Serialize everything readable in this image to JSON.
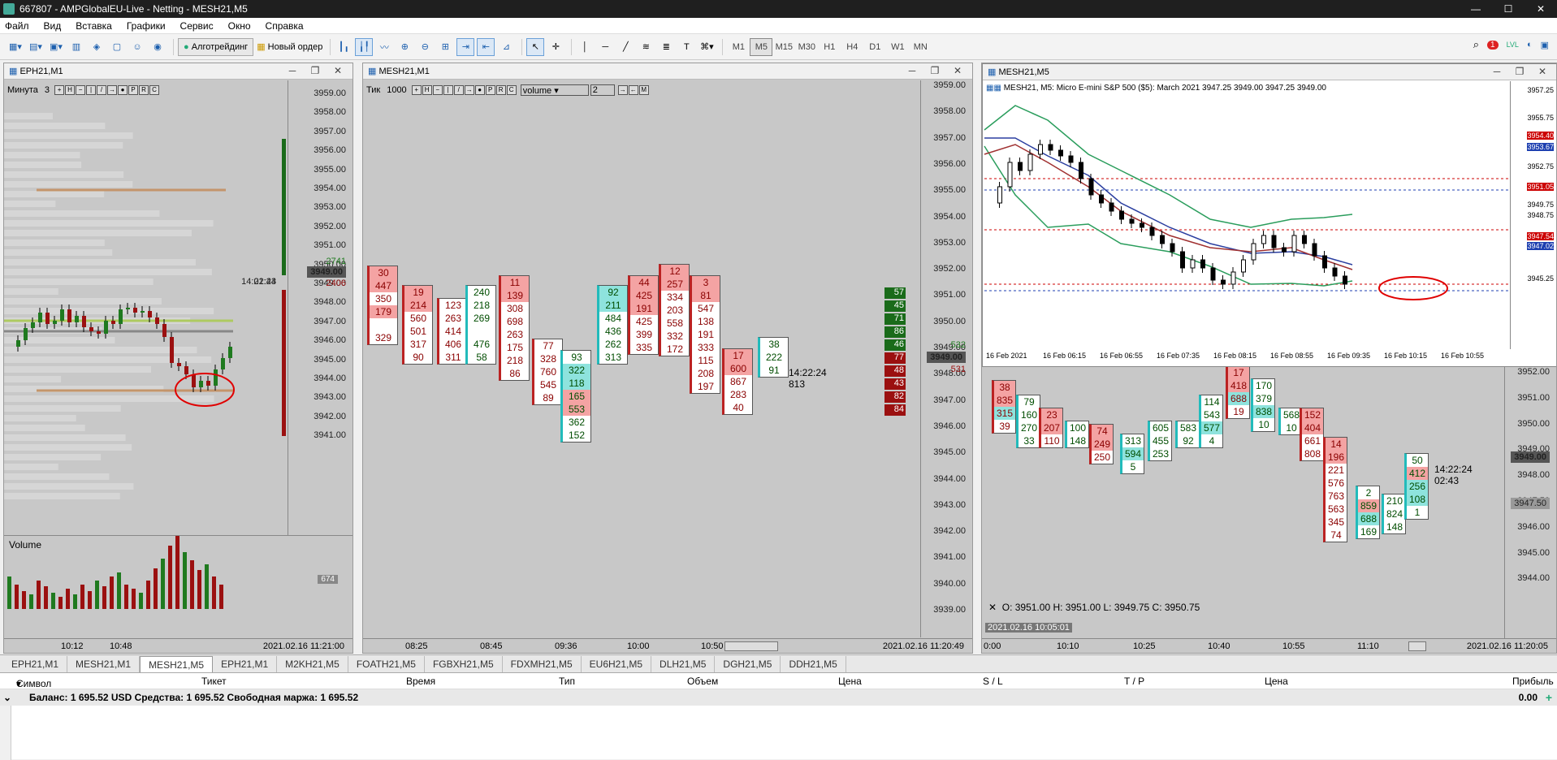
{
  "app": {
    "title": "667807 - AMPGlobalEU-Live - Netting - MESH21,M5",
    "window_controls": [
      "—",
      "☐",
      "✕"
    ]
  },
  "menu": [
    "Файл",
    "Вид",
    "Вставка",
    "Графики",
    "Сервис",
    "Окно",
    "Справка"
  ],
  "toolbar": {
    "algo_label": "Алготрейдинг",
    "new_order_label": "Новый ордер",
    "timeframes": [
      "M1",
      "M5",
      "M15",
      "M30",
      "H1",
      "H4",
      "D1",
      "W1",
      "MN"
    ],
    "active_tf": "M5",
    "notification_count": "1",
    "lvl_label": "LVL"
  },
  "left_chart": {
    "title": "EPH21,M1",
    "period_label": "Минута",
    "period_value": "3",
    "prices": [
      "3959.00",
      "3958.00",
      "3957.00",
      "3956.00",
      "3955.00",
      "3954.00",
      "3953.00",
      "3952.00",
      "3951.00",
      "3950.00",
      "3949.00",
      "3948.00",
      "3947.00",
      "3946.00",
      "3945.00",
      "3944.00",
      "3943.00",
      "3942.00",
      "3941.00"
    ],
    "current_price": "3949.00",
    "bid_marker": "2741",
    "ask_marker": "2406",
    "clock_time": "14:22:24",
    "clock_countdown": "01:43",
    "volume_label": "Volume",
    "volume_value": "674",
    "time_labels": [
      "10:12",
      "10:48"
    ],
    "datetime": "2021.02.16 11:21:00"
  },
  "mid_chart": {
    "title": "MESH21,M1",
    "tick_label": "Тик",
    "tick_value": "1000",
    "volume_select": "volume",
    "volume_num": "2",
    "prices": [
      "3959.00",
      "3958.00",
      "3957.00",
      "3956.00",
      "3955.00",
      "3954.00",
      "3953.00",
      "3952.00",
      "3951.00",
      "3950.00",
      "3949.00",
      "3948.00",
      "3947.00",
      "3946.00",
      "3945.00",
      "3944.00",
      "3943.00",
      "3942.00",
      "3941.00",
      "3940.00",
      "3939.00"
    ],
    "current_price": "3949.00",
    "ask_marker": "532",
    "bid_marker": "531",
    "clock_time": "14:22:24",
    "clock_extra": "813",
    "time_labels": [
      "08:25",
      "08:45",
      "09:36",
      "10:00",
      "10:50"
    ],
    "datetime": "2021.02.16 11:20:49",
    "depth": [
      {
        "v": "57",
        "c": "g"
      },
      {
        "v": "45",
        "c": "g"
      },
      {
        "v": "71",
        "c": "g"
      },
      {
        "v": "86",
        "c": "g"
      },
      {
        "v": "46",
        "c": "g"
      },
      {
        "v": "77",
        "c": "r"
      },
      {
        "v": "48",
        "c": "r"
      },
      {
        "v": "43",
        "c": "r"
      },
      {
        "v": "82",
        "c": "r"
      },
      {
        "v": "84",
        "c": "r"
      }
    ],
    "columns": [
      {
        "dir": "dn",
        "cells": [
          [
            "30",
            "hl-r"
          ],
          [
            "447",
            "hl-r"
          ],
          [
            "350",
            ""
          ],
          [
            "179",
            "hl-r"
          ],
          [
            "",
            ""
          ],
          [
            "329",
            ""
          ]
        ]
      },
      {
        "dir": "dn",
        "cells": [
          [
            "19",
            "hl-r"
          ],
          [
            "214",
            "hl-r"
          ],
          [
            "560",
            ""
          ],
          [
            "501",
            ""
          ],
          [
            "317",
            ""
          ],
          [
            "90",
            ""
          ]
        ]
      },
      {
        "dir": "dn",
        "cells": [
          [
            "123",
            ""
          ],
          [
            "263",
            ""
          ],
          [
            "414",
            ""
          ],
          [
            "406",
            ""
          ],
          [
            "311",
            ""
          ]
        ]
      },
      {
        "dir": "up",
        "cells": [
          [
            "240",
            ""
          ],
          [
            "218",
            ""
          ],
          [
            "269",
            ""
          ],
          [
            "",
            ""
          ],
          [
            "476",
            ""
          ],
          [
            "58",
            ""
          ]
        ]
      },
      {
        "dir": "dn",
        "cells": [
          [
            "11",
            "hl-r"
          ],
          [
            "139",
            "hl-r"
          ],
          [
            "308",
            ""
          ],
          [
            "698",
            ""
          ],
          [
            "263",
            ""
          ],
          [
            "175",
            ""
          ],
          [
            "218",
            ""
          ],
          [
            "86",
            ""
          ]
        ]
      },
      {
        "dir": "dn",
        "cells": [
          [
            "77",
            ""
          ],
          [
            "328",
            ""
          ],
          [
            "760",
            ""
          ],
          [
            "545",
            ""
          ],
          [
            "89",
            ""
          ]
        ]
      },
      {
        "dir": "up",
        "cells": [
          [
            "93",
            ""
          ],
          [
            "322",
            "hl-g"
          ],
          [
            "118",
            "hl-g"
          ],
          [
            "165",
            "hl-r"
          ],
          [
            "553",
            "hl-r"
          ],
          [
            "362",
            ""
          ],
          [
            "152",
            ""
          ]
        ]
      },
      {
        "dir": "up",
        "cells": [
          [
            "92",
            "hl-g"
          ],
          [
            "211",
            "hl-g"
          ],
          [
            "484",
            ""
          ],
          [
            "436",
            ""
          ],
          [
            "262",
            ""
          ],
          [
            "313",
            ""
          ]
        ]
      },
      {
        "dir": "dn",
        "cells": [
          [
            "44",
            "hl-r"
          ],
          [
            "425",
            "hl-r"
          ],
          [
            "191",
            "hl-r"
          ],
          [
            "425",
            ""
          ],
          [
            "399",
            ""
          ],
          [
            "335",
            ""
          ]
        ]
      },
      {
        "dir": "dn",
        "cells": [
          [
            "12",
            "hl-r"
          ],
          [
            "257",
            "hl-r"
          ],
          [
            "334",
            ""
          ],
          [
            "203",
            ""
          ],
          [
            "558",
            ""
          ],
          [
            "332",
            ""
          ],
          [
            "172",
            ""
          ]
        ]
      },
      {
        "dir": "dn",
        "cells": [
          [
            "3",
            "hl-r"
          ],
          [
            "81",
            "hl-r"
          ],
          [
            "547",
            ""
          ],
          [
            "138",
            ""
          ],
          [
            "191",
            ""
          ],
          [
            "333",
            ""
          ],
          [
            "115",
            ""
          ],
          [
            "208",
            ""
          ],
          [
            "197",
            ""
          ]
        ]
      },
      {
        "dir": "dn",
        "cells": [
          [
            "17",
            "hl-r"
          ],
          [
            "600",
            "hl-r"
          ],
          [
            "867",
            ""
          ],
          [
            "283",
            ""
          ],
          [
            "40",
            ""
          ]
        ]
      },
      {
        "dir": "up",
        "cells": [
          [
            "38",
            ""
          ],
          [
            "222",
            ""
          ],
          [
            "91",
            ""
          ]
        ]
      }
    ]
  },
  "right_chart": {
    "title": "MESH21,M5",
    "inset_title": "MESH21,M5",
    "inset_info": "MESH21, M5:  Micro E-mini S&P 500 ($5): March 2021  3947.25 3949.00 3947.25 3949.00",
    "inset_prices": [
      "3957.25",
      "3955.75",
      "3954.40",
      "3953.67",
      "3952.75",
      "3951.05",
      "3949.75",
      "3948.75",
      "3947.54",
      "3947.02",
      "3945.25"
    ],
    "inset_time_labels": [
      "16 Feb 2021",
      "16 Feb 06:15",
      "16 Feb 06:55",
      "16 Feb 07:35",
      "16 Feb 08:15",
      "16 Feb 08:55",
      "16 Feb 09:35",
      "16 Feb 10:15",
      "16 Feb 10:55"
    ],
    "prices": [
      "3952.00",
      "3951.00",
      "3950.00",
      "3949.00",
      "3948.00",
      "3947.50",
      "3946.00",
      "3945.00",
      "3944.00"
    ],
    "current_price": "3949.00",
    "line_price": "3947.50",
    "clock_time": "14:22:24",
    "clock_countdown": "02:43",
    "ohlc": "O: 3951.00   H: 3951.00   L: 3949.75   C: 3950.75",
    "crosshair_date": "2021.02.16 10:05:01",
    "time_labels": [
      "0:00",
      "10:10",
      "10:25",
      "10:40",
      "10:55",
      "11:10"
    ],
    "datetime": "2021.02.16 11:20:05",
    "columns": [
      {
        "dir": "dn",
        "cells": [
          [
            "38",
            "hl-r"
          ],
          [
            "835",
            "hl-r"
          ],
          [
            "315",
            "hl-g"
          ],
          [
            "39",
            ""
          ]
        ]
      },
      {
        "dir": "up",
        "cells": [
          [
            "79",
            ""
          ],
          [
            "160",
            ""
          ],
          [
            "270",
            ""
          ],
          [
            "33",
            ""
          ]
        ]
      },
      {
        "dir": "dn",
        "cells": [
          [
            "23",
            "hl-r"
          ],
          [
            "207",
            "hl-r"
          ],
          [
            "110",
            ""
          ]
        ]
      },
      {
        "dir": "up",
        "cells": [
          [
            "100",
            ""
          ],
          [
            "148",
            ""
          ]
        ]
      },
      {
        "dir": "dn",
        "cells": [
          [
            "74",
            "hl-r"
          ],
          [
            "249",
            "hl-r"
          ],
          [
            "250",
            ""
          ]
        ]
      },
      {
        "dir": "up",
        "cells": [
          [
            "313",
            ""
          ],
          [
            "594",
            "hl-g"
          ],
          [
            "5",
            ""
          ]
        ]
      },
      {
        "dir": "up",
        "cells": [
          [
            "605",
            ""
          ],
          [
            "455",
            ""
          ],
          [
            "253",
            ""
          ]
        ]
      },
      {
        "dir": "up",
        "cells": [
          [
            "583",
            ""
          ],
          [
            "92",
            ""
          ]
        ]
      },
      {
        "dir": "up",
        "cells": [
          [
            "114",
            ""
          ],
          [
            "543",
            ""
          ],
          [
            "577",
            "hl-g"
          ],
          [
            "4",
            ""
          ]
        ]
      },
      {
        "dir": "dn",
        "cells": [
          [
            "17",
            "hl-r"
          ],
          [
            "418",
            "hl-r"
          ],
          [
            "688",
            "hl-g"
          ],
          [
            "19",
            ""
          ]
        ]
      },
      {
        "dir": "up",
        "cells": [
          [
            "170",
            ""
          ],
          [
            "379",
            ""
          ],
          [
            "838",
            "hl-g"
          ],
          [
            "10",
            ""
          ]
        ]
      },
      {
        "dir": "up",
        "cells": [
          [
            "568",
            ""
          ],
          [
            "10",
            ""
          ]
        ]
      },
      {
        "dir": "dn",
        "cells": [
          [
            "152",
            "hl-r"
          ],
          [
            "404",
            "hl-r"
          ],
          [
            "661",
            ""
          ],
          [
            "808",
            ""
          ]
        ]
      },
      {
        "dir": "dn",
        "cells": [
          [
            "14",
            "hl-r"
          ],
          [
            "196",
            "hl-r"
          ],
          [
            "221",
            ""
          ],
          [
            "576",
            ""
          ],
          [
            "763",
            ""
          ],
          [
            "563",
            ""
          ],
          [
            "345",
            ""
          ],
          [
            "74",
            ""
          ]
        ]
      },
      {
        "dir": "up",
        "cells": [
          [
            "2",
            ""
          ],
          [
            "859",
            "hl-r"
          ],
          [
            "688",
            "hl-g"
          ],
          [
            "169",
            ""
          ]
        ]
      },
      {
        "dir": "up",
        "cells": [
          [
            "210",
            ""
          ],
          [
            "824",
            ""
          ],
          [
            "148",
            ""
          ]
        ]
      },
      {
        "dir": "up",
        "cells": [
          [
            "50",
            ""
          ],
          [
            "412",
            "hl-r"
          ],
          [
            "256",
            "hl-g"
          ],
          [
            "108",
            "hl-g"
          ],
          [
            "1",
            ""
          ]
        ]
      }
    ]
  },
  "tabs": [
    "EPH21,M1",
    "MESH21,M1",
    "MESH21,M5",
    "EPH21,M1",
    "M2KH21,M5",
    "FOATH21,M5",
    "FGBXH21,M5",
    "FDXMH21,M5",
    "EU6H21,M5",
    "DLH21,M5",
    "DGH21,M5",
    "DDH21,M5"
  ],
  "active_tab": 2,
  "terminal": {
    "columns": [
      "Символ",
      "Тикет",
      "Время",
      "Тип",
      "Объем",
      "Цена",
      "S / L",
      "T / P",
      "Цена",
      "Прибыль"
    ],
    "balance_text": "Баланс: 1 695.52 USD  Средства: 1 695.52  Свободная маржа: 1 695.52",
    "profit": "0.00"
  },
  "colors": {
    "bull": "#1f7a1f",
    "bear": "#9b1010",
    "accent_cyan": "#2bb",
    "chart_bg": "#c8c8c8",
    "annotation": "#e00000"
  }
}
